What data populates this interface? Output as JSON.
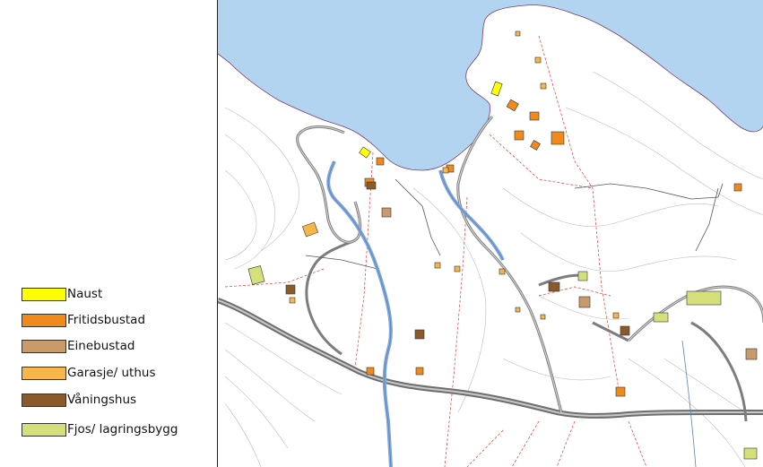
{
  "legend": {
    "items": [
      {
        "label": "Naust",
        "color": "#ffff00"
      },
      {
        "label": "Fritidsbustad",
        "color": "#f08a1c"
      },
      {
        "label": "Einebustad",
        "color": "#c99a6a"
      },
      {
        "label": "Garasje/ uthus",
        "color": "#f7b649"
      },
      {
        "label": "Våningshus",
        "color": "#8b5a2b"
      },
      {
        "label": "Fjos/ lagringsbygg",
        "color": "#d6e07a"
      }
    ]
  },
  "map": {
    "water_color": "#b3d4f0",
    "land_color": "#ffffff",
    "road_color": "#8c8c8c",
    "property_line_color": "#e53935",
    "stream_color": "#7fa7d9"
  }
}
